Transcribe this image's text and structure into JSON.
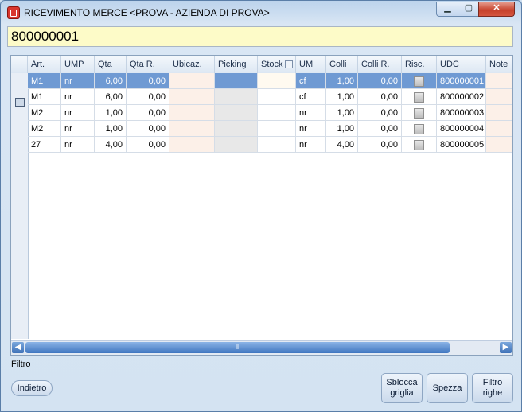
{
  "window": {
    "title": "RICEVIMENTO MERCE <PROVA - AZIENDA DI PROVA>",
    "min_glyph": "▁",
    "max_glyph": "▢",
    "close_glyph": "✕"
  },
  "search": {
    "value": "800000001"
  },
  "grid": {
    "columns": [
      "Art.",
      "UMP",
      "Qta",
      "Qta R.",
      "Ubicaz.",
      "Picking",
      "Stock",
      "UM",
      "Colli",
      "Colli R.",
      "Risc.",
      "UDC",
      "Note"
    ],
    "rows": [
      {
        "art": "M1",
        "ump": "nr",
        "qta": "6,00",
        "qta_r": "0,00",
        "um": "cf",
        "colli": "1,00",
        "colli_r": "0,00",
        "udc": "800000001"
      },
      {
        "art": "M1",
        "ump": "nr",
        "qta": "6,00",
        "qta_r": "0,00",
        "um": "cf",
        "colli": "1,00",
        "colli_r": "0,00",
        "udc": "800000002"
      },
      {
        "art": "M2",
        "ump": "nr",
        "qta": "1,00",
        "qta_r": "0,00",
        "um": "nr",
        "colli": "1,00",
        "colli_r": "0,00",
        "udc": "800000003"
      },
      {
        "art": "M2",
        "ump": "nr",
        "qta": "1,00",
        "qta_r": "0,00",
        "um": "nr",
        "colli": "1,00",
        "colli_r": "0,00",
        "udc": "800000004"
      },
      {
        "art": "27",
        "ump": "nr",
        "qta": "4,00",
        "qta_r": "0,00",
        "um": "nr",
        "colli": "4,00",
        "colli_r": "0,00",
        "udc": "800000005"
      }
    ],
    "selected_row": 0,
    "scroll_left_glyph": "◀",
    "scroll_right_glyph": "▶",
    "scroll_thumb_glyph": "⦀"
  },
  "filter_label": "Filtro",
  "buttons": {
    "back": "Indietro",
    "unlock_grid": "Sblocca griglia",
    "split": "Spezza",
    "filter_rows": "Filtro righe"
  },
  "colors": {
    "selection": "#6f9ad3",
    "search_bg": "#fdfbc8",
    "close_button": "#c7412b"
  }
}
